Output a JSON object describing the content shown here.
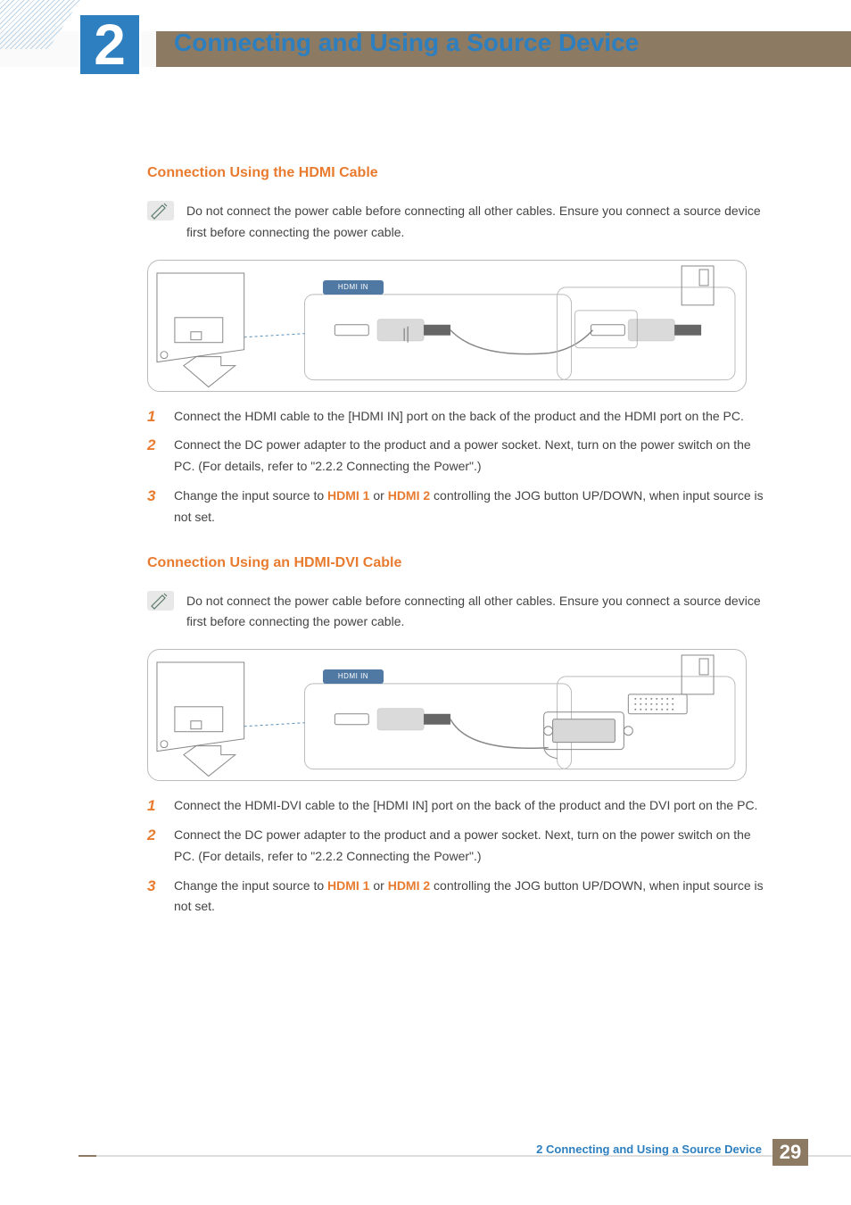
{
  "chapter": {
    "number": "2",
    "title": "Connecting and Using a Source Device"
  },
  "sections": [
    {
      "heading": "Connection Using the HDMI Cable",
      "note": "Do not connect the power cable before connecting all other cables. Ensure you connect a source device first before connecting the power cable.",
      "port_label": "HDMI IN",
      "steps": [
        {
          "pre": "Connect the HDMI cable to the [HDMI IN] port on the back of the product and the HDMI port on the PC."
        },
        {
          "pre": "Connect the DC power adapter to the product and a power socket. Next, turn on the power switch on the PC. (For details, refer to \"2.2.2    Connecting the Power\".)"
        },
        {
          "pre": "Change the input source to ",
          "b1": "HDMI 1",
          "mid": " or ",
          "b2": "HDMI 2",
          "post": " controlling the JOG button UP/DOWN, when input source is not set."
        }
      ]
    },
    {
      "heading": "Connection Using an HDMI-DVI Cable",
      "note": "Do not connect the power cable before connecting all other cables. Ensure you connect a source device first before connecting the power cable.",
      "port_label": "HDMI IN",
      "steps": [
        {
          "pre": "Connect the HDMI-DVI cable to the [HDMI IN] port on the back of the product and the DVI port on the PC."
        },
        {
          "pre": "Connect the DC power adapter to the product and a power socket. Next, turn on the power switch on the PC. (For details, refer to \"2.2.2    Connecting the Power\".)"
        },
        {
          "pre": "Change the input source to ",
          "b1": "HDMI 1",
          "mid": " or ",
          "b2": "HDMI 2",
          "post": " controlling the JOG button UP/DOWN, when input source is not set."
        }
      ]
    }
  ],
  "footer": {
    "text": "2 Connecting and Using a Source Device",
    "page": "29"
  }
}
